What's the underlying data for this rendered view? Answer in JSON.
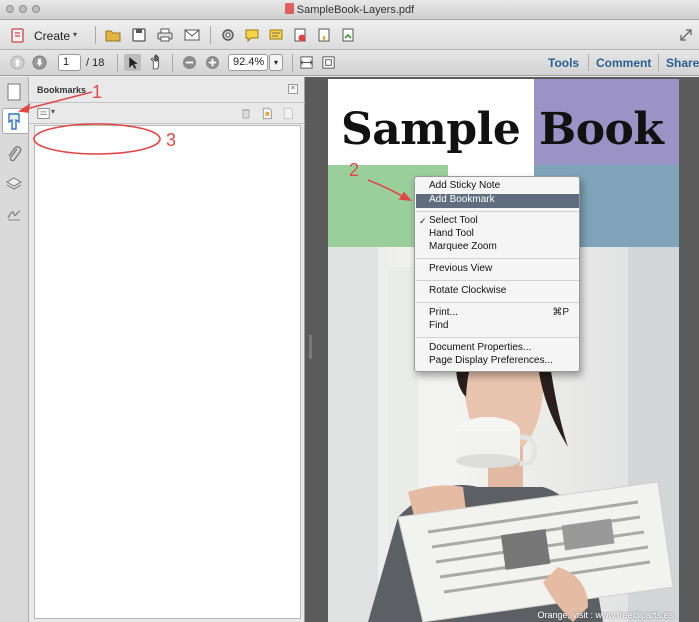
{
  "window": {
    "title": "SampleBook-Layers.pdf"
  },
  "toolbar": {
    "create_label": "Create",
    "page_current": "1",
    "page_total": "/ 18",
    "zoom": "92.4%",
    "tabs": {
      "tools": "Tools",
      "comment": "Comment",
      "share": "Share"
    }
  },
  "bookmarks_panel": {
    "title": "Bookmarks"
  },
  "document": {
    "title_word1": "Sample",
    "title_word2": "Book",
    "watermark": "Orange, visit : www.freecliparts.es",
    "colors": {
      "purple": "#9b92c6",
      "green": "#9acf9c",
      "steel": "#7fa4b9"
    }
  },
  "context_menu": {
    "items": [
      {
        "label": "Add Sticky Note"
      },
      {
        "label": "Add Bookmark",
        "highlighted": true
      },
      {
        "label": "Select Tool",
        "checked": true
      },
      {
        "label": "Hand Tool"
      },
      {
        "label": "Marquee Zoom"
      },
      {
        "label": "Previous View"
      },
      {
        "label": "Rotate Clockwise"
      },
      {
        "label": "Print...",
        "shortcut": "⌘P"
      },
      {
        "label": "Find"
      },
      {
        "label": "Document Properties..."
      },
      {
        "label": "Page Display Preferences..."
      }
    ]
  },
  "annotations": {
    "one": "1",
    "two": "2",
    "three": "3",
    "color": "#e04848"
  }
}
